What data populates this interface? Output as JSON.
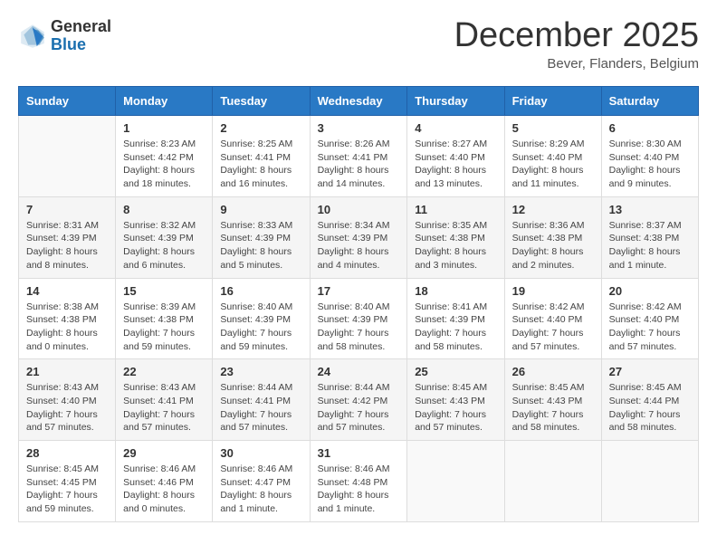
{
  "header": {
    "logo_general": "General",
    "logo_blue": "Blue",
    "month_title": "December 2025",
    "location": "Bever, Flanders, Belgium"
  },
  "days_of_week": [
    "Sunday",
    "Monday",
    "Tuesday",
    "Wednesday",
    "Thursday",
    "Friday",
    "Saturday"
  ],
  "weeks": [
    [
      {
        "day": "",
        "detail": ""
      },
      {
        "day": "1",
        "detail": "Sunrise: 8:23 AM\nSunset: 4:42 PM\nDaylight: 8 hours\nand 18 minutes."
      },
      {
        "day": "2",
        "detail": "Sunrise: 8:25 AM\nSunset: 4:41 PM\nDaylight: 8 hours\nand 16 minutes."
      },
      {
        "day": "3",
        "detail": "Sunrise: 8:26 AM\nSunset: 4:41 PM\nDaylight: 8 hours\nand 14 minutes."
      },
      {
        "day": "4",
        "detail": "Sunrise: 8:27 AM\nSunset: 4:40 PM\nDaylight: 8 hours\nand 13 minutes."
      },
      {
        "day": "5",
        "detail": "Sunrise: 8:29 AM\nSunset: 4:40 PM\nDaylight: 8 hours\nand 11 minutes."
      },
      {
        "day": "6",
        "detail": "Sunrise: 8:30 AM\nSunset: 4:40 PM\nDaylight: 8 hours\nand 9 minutes."
      }
    ],
    [
      {
        "day": "7",
        "detail": "Sunrise: 8:31 AM\nSunset: 4:39 PM\nDaylight: 8 hours\nand 8 minutes."
      },
      {
        "day": "8",
        "detail": "Sunrise: 8:32 AM\nSunset: 4:39 PM\nDaylight: 8 hours\nand 6 minutes."
      },
      {
        "day": "9",
        "detail": "Sunrise: 8:33 AM\nSunset: 4:39 PM\nDaylight: 8 hours\nand 5 minutes."
      },
      {
        "day": "10",
        "detail": "Sunrise: 8:34 AM\nSunset: 4:39 PM\nDaylight: 8 hours\nand 4 minutes."
      },
      {
        "day": "11",
        "detail": "Sunrise: 8:35 AM\nSunset: 4:38 PM\nDaylight: 8 hours\nand 3 minutes."
      },
      {
        "day": "12",
        "detail": "Sunrise: 8:36 AM\nSunset: 4:38 PM\nDaylight: 8 hours\nand 2 minutes."
      },
      {
        "day": "13",
        "detail": "Sunrise: 8:37 AM\nSunset: 4:38 PM\nDaylight: 8 hours\nand 1 minute."
      }
    ],
    [
      {
        "day": "14",
        "detail": "Sunrise: 8:38 AM\nSunset: 4:38 PM\nDaylight: 8 hours\nand 0 minutes."
      },
      {
        "day": "15",
        "detail": "Sunrise: 8:39 AM\nSunset: 4:38 PM\nDaylight: 7 hours\nand 59 minutes."
      },
      {
        "day": "16",
        "detail": "Sunrise: 8:40 AM\nSunset: 4:39 PM\nDaylight: 7 hours\nand 59 minutes."
      },
      {
        "day": "17",
        "detail": "Sunrise: 8:40 AM\nSunset: 4:39 PM\nDaylight: 7 hours\nand 58 minutes."
      },
      {
        "day": "18",
        "detail": "Sunrise: 8:41 AM\nSunset: 4:39 PM\nDaylight: 7 hours\nand 58 minutes."
      },
      {
        "day": "19",
        "detail": "Sunrise: 8:42 AM\nSunset: 4:40 PM\nDaylight: 7 hours\nand 57 minutes."
      },
      {
        "day": "20",
        "detail": "Sunrise: 8:42 AM\nSunset: 4:40 PM\nDaylight: 7 hours\nand 57 minutes."
      }
    ],
    [
      {
        "day": "21",
        "detail": "Sunrise: 8:43 AM\nSunset: 4:40 PM\nDaylight: 7 hours\nand 57 minutes."
      },
      {
        "day": "22",
        "detail": "Sunrise: 8:43 AM\nSunset: 4:41 PM\nDaylight: 7 hours\nand 57 minutes."
      },
      {
        "day": "23",
        "detail": "Sunrise: 8:44 AM\nSunset: 4:41 PM\nDaylight: 7 hours\nand 57 minutes."
      },
      {
        "day": "24",
        "detail": "Sunrise: 8:44 AM\nSunset: 4:42 PM\nDaylight: 7 hours\nand 57 minutes."
      },
      {
        "day": "25",
        "detail": "Sunrise: 8:45 AM\nSunset: 4:43 PM\nDaylight: 7 hours\nand 57 minutes."
      },
      {
        "day": "26",
        "detail": "Sunrise: 8:45 AM\nSunset: 4:43 PM\nDaylight: 7 hours\nand 58 minutes."
      },
      {
        "day": "27",
        "detail": "Sunrise: 8:45 AM\nSunset: 4:44 PM\nDaylight: 7 hours\nand 58 minutes."
      }
    ],
    [
      {
        "day": "28",
        "detail": "Sunrise: 8:45 AM\nSunset: 4:45 PM\nDaylight: 7 hours\nand 59 minutes."
      },
      {
        "day": "29",
        "detail": "Sunrise: 8:46 AM\nSunset: 4:46 PM\nDaylight: 8 hours\nand 0 minutes."
      },
      {
        "day": "30",
        "detail": "Sunrise: 8:46 AM\nSunset: 4:47 PM\nDaylight: 8 hours\nand 1 minute."
      },
      {
        "day": "31",
        "detail": "Sunrise: 8:46 AM\nSunset: 4:48 PM\nDaylight: 8 hours\nand 1 minute."
      },
      {
        "day": "",
        "detail": ""
      },
      {
        "day": "",
        "detail": ""
      },
      {
        "day": "",
        "detail": ""
      }
    ]
  ]
}
